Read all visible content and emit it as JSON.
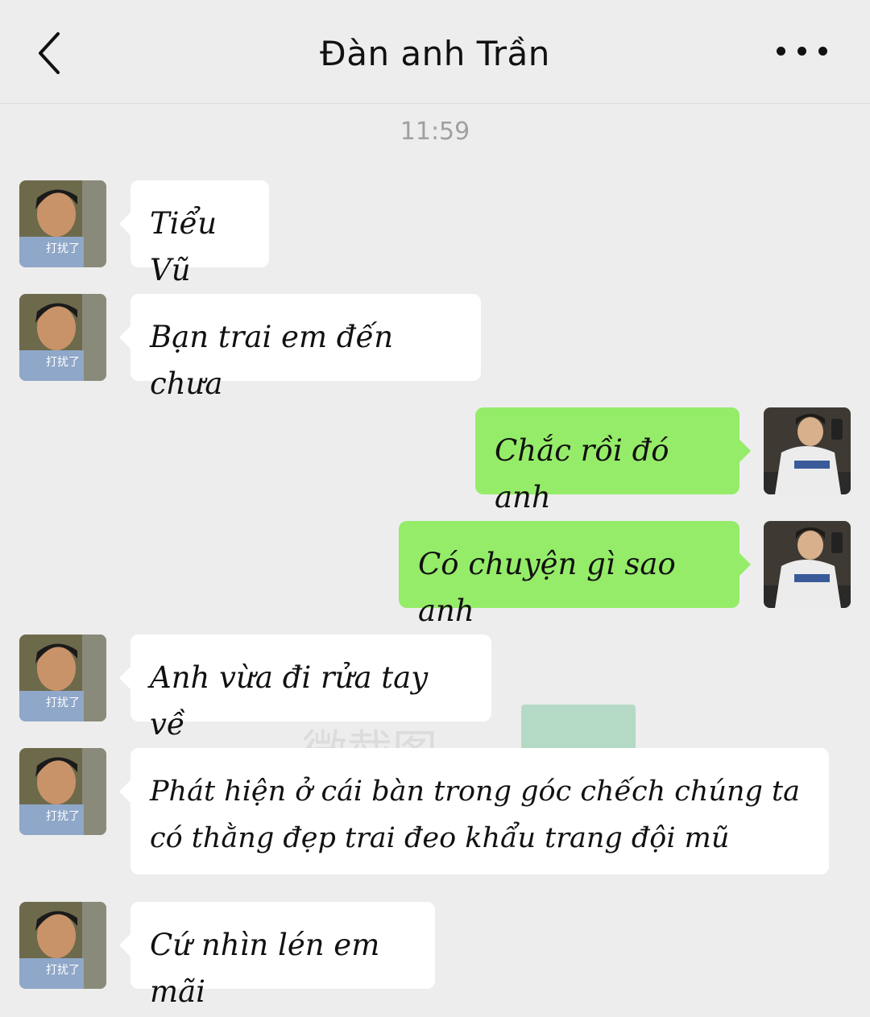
{
  "header": {
    "title": "Đàn anh Trần",
    "back_icon": "chevron-left-icon",
    "more_icon": "more-horizontal-icon"
  },
  "timestamp": "11:59",
  "avatar_caption": "打扰了",
  "messages": [
    {
      "side": "in",
      "text": "Tiểu Vũ"
    },
    {
      "side": "in",
      "text": "Bạn trai em đến chưa"
    },
    {
      "side": "out",
      "text": "Chắc rồi đó anh"
    },
    {
      "side": "out",
      "text": "Có chuyện gì sao anh"
    },
    {
      "side": "in",
      "text": "Anh vừa đi rửa tay về"
    },
    {
      "side": "in",
      "text": "Phát hiện ở cái bàn trong góc chếch chúng ta có thằng đẹp trai đeo khẩu trang đội mũ"
    },
    {
      "side": "in",
      "text": "Cứ nhìn lén em mãi"
    }
  ],
  "colors": {
    "background": "#ededed",
    "incoming_bubble": "#ffffff",
    "outgoing_bubble": "#95ec69"
  }
}
